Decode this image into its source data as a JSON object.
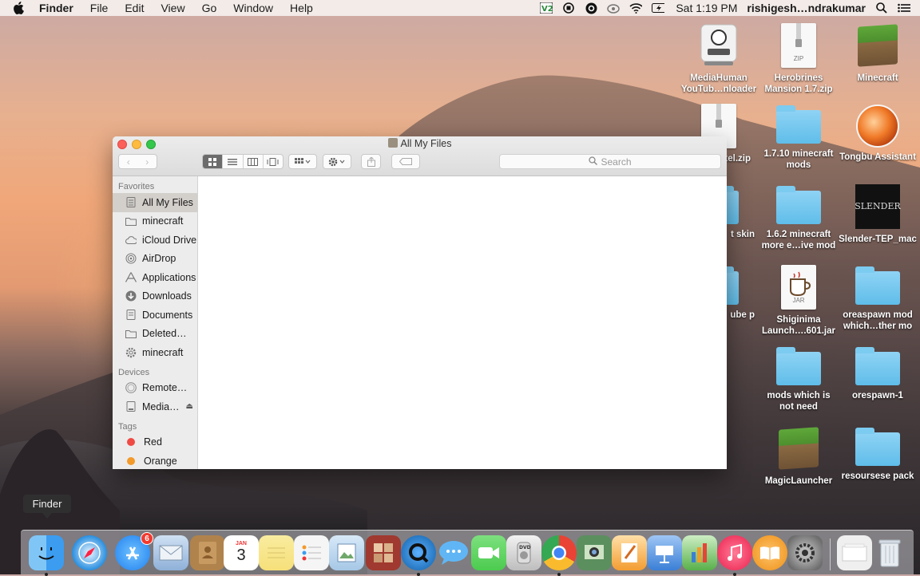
{
  "menubar": {
    "app_name": "Finder",
    "menus": [
      "File",
      "Edit",
      "View",
      "Go",
      "Window",
      "Help"
    ],
    "clock": "Sat 1:19 PM",
    "username": "rishigesh…ndrakumar"
  },
  "desktop": {
    "icons": [
      {
        "label": "MediaHuman YouTub…nloader",
        "kind": "app"
      },
      {
        "label": "Herobrines Mansion 1.7.zip",
        "kind": "zip"
      },
      {
        "label": "Minecraft",
        "kind": "grass"
      },
      {
        "label": "nes xel.zip",
        "kind": "zip"
      },
      {
        "label": "1.7.10 minecraft mods",
        "kind": "folder"
      },
      {
        "label": "Tongbu Assistant",
        "kind": "orb"
      },
      {
        "label": "t skin",
        "kind": "folder"
      },
      {
        "label": "1.6.2 minecraft more e…ive mod",
        "kind": "folder"
      },
      {
        "label": "Slender-TEP_mac",
        "kind": "slender"
      },
      {
        "label": "ube p",
        "kind": "folder"
      },
      {
        "label": "Shiginima Launch….601.jar",
        "kind": "jar"
      },
      {
        "label": "oreaspawn mod which…ther mo",
        "kind": "folder"
      },
      {
        "label": "mods which is not need",
        "kind": "folder"
      },
      {
        "label": "orespawn-1",
        "kind": "folder"
      },
      {
        "label": "MagicLauncher",
        "kind": "grass"
      },
      {
        "label": "resoursese pack",
        "kind": "folder"
      }
    ],
    "zip_label": "ZIP",
    "jar_label": "JAR",
    "slender_text": "SLENDER"
  },
  "finder": {
    "title": "All My Files",
    "search_placeholder": "Search",
    "sidebar": {
      "favorites_heading": "Favorites",
      "favorites": [
        "All My Files",
        "minecraft",
        "iCloud Drive",
        "AirDrop",
        "Applications",
        "Downloads",
        "Documents",
        "Deleted…",
        "minecraft"
      ],
      "devices_heading": "Devices",
      "devices": [
        "Remote…",
        "Media…"
      ],
      "tags_heading": "Tags",
      "tags": [
        {
          "label": "Red",
          "color": "#f04a45"
        },
        {
          "label": "Orange",
          "color": "#f39a2a"
        }
      ]
    }
  },
  "tooltip": "Finder",
  "dock": {
    "apps": [
      {
        "name": "Finder",
        "color": "#3b9cf0",
        "running": true
      },
      {
        "name": "Safari",
        "color": "#2a8fe0",
        "running": false
      },
      {
        "name": "App Store",
        "color": "#2f8df2",
        "running": false,
        "badge": "6"
      },
      {
        "name": "Mail",
        "color": "#8fb0d8",
        "running": false
      },
      {
        "name": "Contacts",
        "color": "#b0834c",
        "running": false
      },
      {
        "name": "Calendar",
        "color": "#ffffff",
        "running": false,
        "text": "3",
        "month": "JAN"
      },
      {
        "name": "Notes",
        "color": "#f6e07a",
        "running": false
      },
      {
        "name": "Reminders",
        "color": "#f5f5f5",
        "running": false
      },
      {
        "name": "Preview",
        "color": "#a6c7e6",
        "running": false
      },
      {
        "name": "Photo Booth",
        "color": "#a0392f",
        "running": false
      },
      {
        "name": "QuickTime Player",
        "color": "#1f6fb8",
        "running": true
      },
      {
        "name": "Messages",
        "color": "#60b6f5",
        "running": false
      },
      {
        "name": "FaceTime",
        "color": "#4ccb4f",
        "running": false
      },
      {
        "name": "DVD Player",
        "color": "#d8d8d8",
        "running": false
      },
      {
        "name": "Google Chrome",
        "color": "#e84335",
        "running": true
      },
      {
        "name": "iPhoto",
        "color": "#5b8f5e",
        "running": false
      },
      {
        "name": "Pages",
        "color": "#f39d32",
        "running": false
      },
      {
        "name": "Keynote",
        "color": "#3a7fd6",
        "running": false
      },
      {
        "name": "Numbers",
        "color": "#58b04a",
        "running": false
      },
      {
        "name": "iTunes",
        "color": "#f0365f",
        "running": true
      },
      {
        "name": "iBooks",
        "color": "#f19a27",
        "running": false
      },
      {
        "name": "System Preferences",
        "color": "#8a8a8a",
        "running": false
      },
      {
        "name": "Documents Stack",
        "color": "#efefef",
        "running": false
      },
      {
        "name": "Trash",
        "color": "#d7dde3",
        "running": false
      }
    ]
  }
}
